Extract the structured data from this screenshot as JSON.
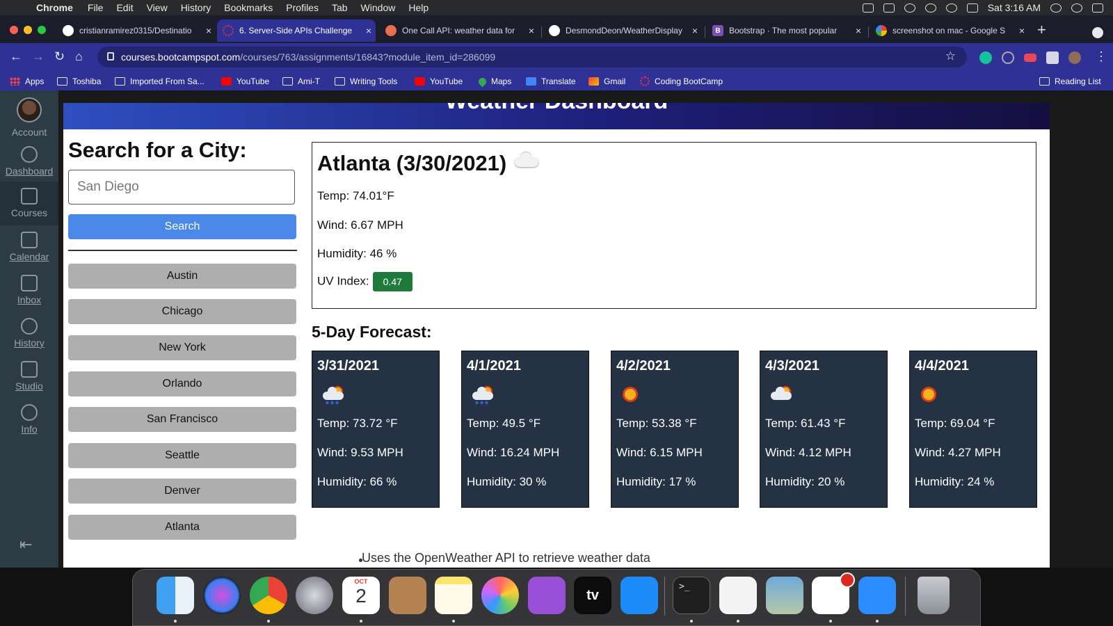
{
  "menubar": {
    "app_name": "Chrome",
    "items": [
      "File",
      "Edit",
      "View",
      "History",
      "Bookmarks",
      "Profiles",
      "Tab",
      "Window",
      "Help"
    ],
    "clock": "Sat 3:16 AM"
  },
  "tabs": [
    {
      "title": "cristianramirez0315/Destinatio",
      "favicon": "github-icon",
      "active": false
    },
    {
      "title": "6. Server-Side APIs Challenge",
      "favicon": "canvas-icon",
      "active": true
    },
    {
      "title": "One Call API: weather data for",
      "favicon": "openweather-icon",
      "active": false
    },
    {
      "title": "DesmondDeon/WeatherDisplay",
      "favicon": "github-icon",
      "active": false
    },
    {
      "title": "Bootstrap · The most popular",
      "favicon": "bootstrap-icon",
      "active": false
    },
    {
      "title": "screenshot on mac - Google S",
      "favicon": "google-icon",
      "active": false
    }
  ],
  "toolbar": {
    "url_host": "courses.bootcampspot.com",
    "url_path": "/courses/763/assignments/16843?module_item_id=286099"
  },
  "bookmarks": [
    {
      "label": "Apps",
      "icon": "apps-grid-icon"
    },
    {
      "label": "Toshiba",
      "icon": "folder-icon"
    },
    {
      "label": "Imported From Sa...",
      "icon": "folder-icon"
    },
    {
      "label": "YouTube",
      "icon": "youtube-icon"
    },
    {
      "label": "Ami-T",
      "icon": "folder-icon"
    },
    {
      "label": "Writing Tools",
      "icon": "folder-icon"
    },
    {
      "label": "YouTube",
      "icon": "youtube-icon"
    },
    {
      "label": "Maps",
      "icon": "maps-icon"
    },
    {
      "label": "Translate",
      "icon": "translate-icon"
    },
    {
      "label": "Gmail",
      "icon": "gmail-icon"
    },
    {
      "label": "Coding BootCamp",
      "icon": "bootcamp-icon"
    }
  ],
  "reading_list": "Reading List",
  "canvas_nav": [
    {
      "label": "Account",
      "icon": "account-icon"
    },
    {
      "label": "Dashboard",
      "icon": "dashboard-icon"
    },
    {
      "label": "Courses",
      "icon": "courses-icon"
    },
    {
      "label": "Calendar",
      "icon": "calendar-icon"
    },
    {
      "label": "Inbox",
      "icon": "inbox-icon"
    },
    {
      "label": "History",
      "icon": "history-icon"
    },
    {
      "label": "Studio",
      "icon": "studio-icon"
    },
    {
      "label": "Info",
      "icon": "info-icon"
    }
  ],
  "weather": {
    "hero_title": "Weather Dashboard",
    "search_title": "Search for a City:",
    "input_placeholder": "San Diego",
    "search_button": "Search",
    "cities": [
      "Austin",
      "Chicago",
      "New York",
      "Orlando",
      "San Francisco",
      "Seattle",
      "Denver",
      "Atlanta"
    ],
    "current": {
      "title": "Atlanta (3/30/2021)",
      "icon": "cloud-icon",
      "temp": "Temp: 74.01°F",
      "wind": "Wind: 6.67 MPH",
      "humidity": "Humidity: 46 %",
      "uv_label": "UV Index:",
      "uv_value": "0.47",
      "uv_color": "#1f7a3e"
    },
    "forecast_title": "5-Day Forecast:",
    "forecast": [
      {
        "date": "3/31/2021",
        "icon": "rain-sun-icon",
        "temp": "Temp: 73.72 °F",
        "wind": "Wind: 9.53 MPH",
        "humidity": "Humidity: 66 %"
      },
      {
        "date": "4/1/2021",
        "icon": "rain-sun-icon",
        "temp": "Temp: 49.5 °F",
        "wind": "Wind: 16.24 MPH",
        "humidity": "Humidity: 30 %"
      },
      {
        "date": "4/2/2021",
        "icon": "sun-icon",
        "temp": "Temp: 53.38 °F",
        "wind": "Wind: 6.15 MPH",
        "humidity": "Humidity: 17 %"
      },
      {
        "date": "4/3/2021",
        "icon": "cloud-sun-icon",
        "temp": "Temp: 61.43 °F",
        "wind": "Wind: 4.12 MPH",
        "humidity": "Humidity: 20 %"
      },
      {
        "date": "4/4/2021",
        "icon": "sun-icon",
        "temp": "Temp: 69.04 °F",
        "wind": "Wind: 4.27 MPH",
        "humidity": "Humidity: 24 %"
      }
    ]
  },
  "below_text": "Uses the OpenWeather API to retrieve weather data",
  "dock": {
    "calendar_month": "OCT",
    "calendar_day": "2",
    "tv_label": "tv",
    "terminal_prompt": ">_"
  }
}
